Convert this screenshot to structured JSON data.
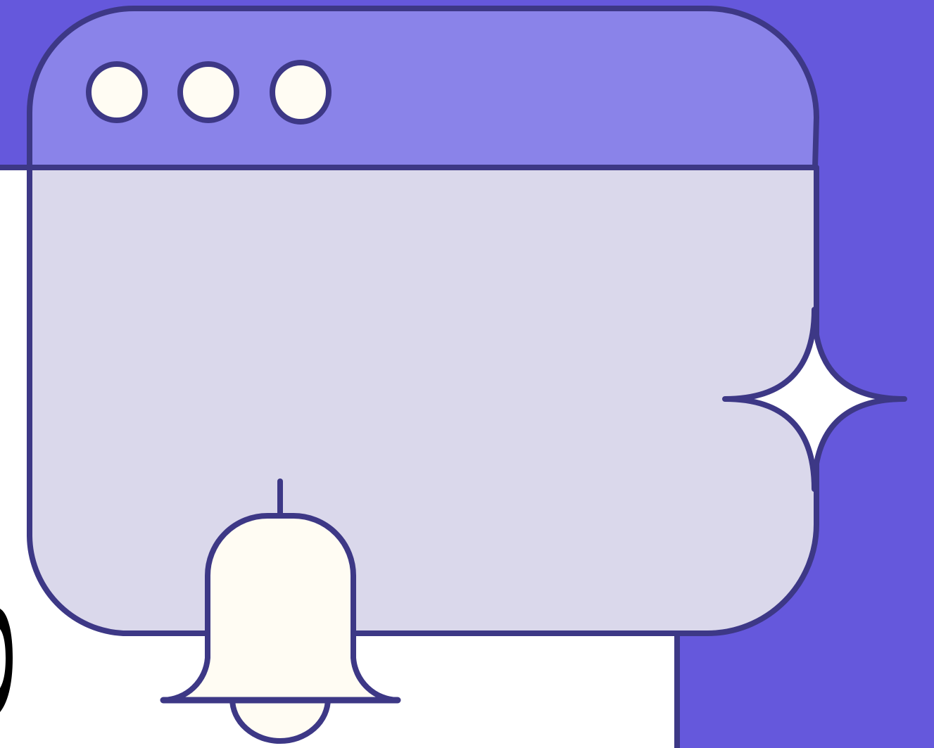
{
  "colors": {
    "background_accent": "#6558DC",
    "window_titlebar": "#8A83E9",
    "window_body": "#DAD8EB",
    "outline": "#3D3886",
    "dot_fill": "#FFFCF3",
    "bell_fill": "#FFFCF3",
    "sparkle_fill": "#FFFFFF",
    "page_background": "#FFFFFF",
    "partial_letter": "#000000"
  },
  "illustration": {
    "icons": [
      "browser-window-icon",
      "bell-icon",
      "sparkle-icon"
    ],
    "window_control_dots": 3
  }
}
